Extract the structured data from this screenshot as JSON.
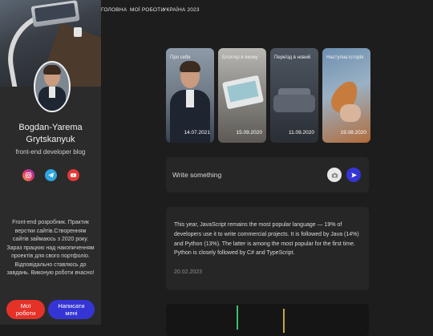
{
  "nav": {
    "items": [
      "ГОЛОВНА",
      "МОЇ РОБОТИ",
      "УКРАЇНА 2023"
    ]
  },
  "sidebar": {
    "name_line1": "Bogdan-Yarema",
    "name_line2": "Grytskanyuk",
    "tagline": "front-end developer blog",
    "socials": [
      "instagram-icon",
      "telegram-icon",
      "youtube-icon"
    ],
    "about": "Front-end розробник. Практик верстки сайтів.Створенням сайтів займаюсь з 2020 року. Зараз працюю над накопиченням проектів для свого портфоліо. Відповідально ставлюсь до завдань. Виконую роботи вчасно!",
    "btn_works": "Мої роботи",
    "btn_write": "Написати мені"
  },
  "stories": [
    {
      "title": "Про себе",
      "date": "14.07.2021"
    },
    {
      "title": "Блоггер в якому",
      "date": "15.09.2020"
    },
    {
      "title": "Переїзд в новий",
      "date": "11.09.2020"
    },
    {
      "title": "Наступна історія",
      "date": "19.08.2020"
    }
  ],
  "composer": {
    "placeholder": "Write something"
  },
  "post": {
    "text": "This year, JavaScript remains the most popular language — 19% of developers use it to write commercial projects. It is followed by Java (14%) and Python (13%). The latter is among the most popular for the first time. Python is closely followed by C# and TypeScript.",
    "date": "20.02.2023"
  },
  "colors": {
    "accent_blue": "#3535d6",
    "accent_red": "#e53228"
  }
}
